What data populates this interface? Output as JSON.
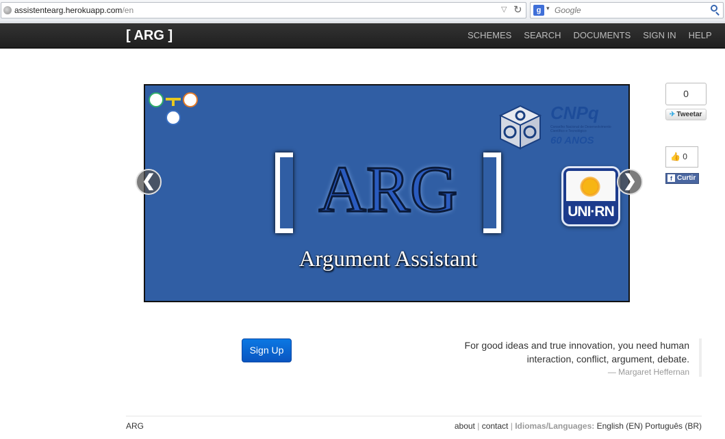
{
  "browser": {
    "url_host": "assistentearg.herokuapp.com",
    "url_path": "/en",
    "search_placeholder": "Google",
    "search_engine_letter": "g"
  },
  "navbar": {
    "brand": "[ ARG ]",
    "items": [
      "SCHEMES",
      "SEARCH",
      "DOCUMENTS",
      "SIGN IN",
      "HELP"
    ]
  },
  "carousel": {
    "title": "ARG",
    "subtitle": "Argument Assistant",
    "logo_cnpq_name": "CNPq",
    "logo_cnpq_sub": "Conselho Nacional de Desenvolvimento Científico e Tecnológico",
    "logo_cnpq_anos": "60 ANOS",
    "logo_unirn": "UNI·RN",
    "prev_icon": "❮",
    "next_icon": "❯"
  },
  "social": {
    "tweet_count": "0",
    "tweet_label": "Tweetar",
    "like_count": "0",
    "like_label": "Curtir"
  },
  "signup_label": "Sign Up",
  "quote": {
    "line1": "For good ideas and true innovation, you need human",
    "line2": "interaction, conflict, argument, debate.",
    "author": "— Margaret Heffernan"
  },
  "footer": {
    "brand": "ARG",
    "about": "about",
    "contact": "contact",
    "languages_label": "Idiomas/Languages:",
    "lang_en": "English (EN)",
    "lang_br": "Português (BR)",
    "separator": "|"
  }
}
